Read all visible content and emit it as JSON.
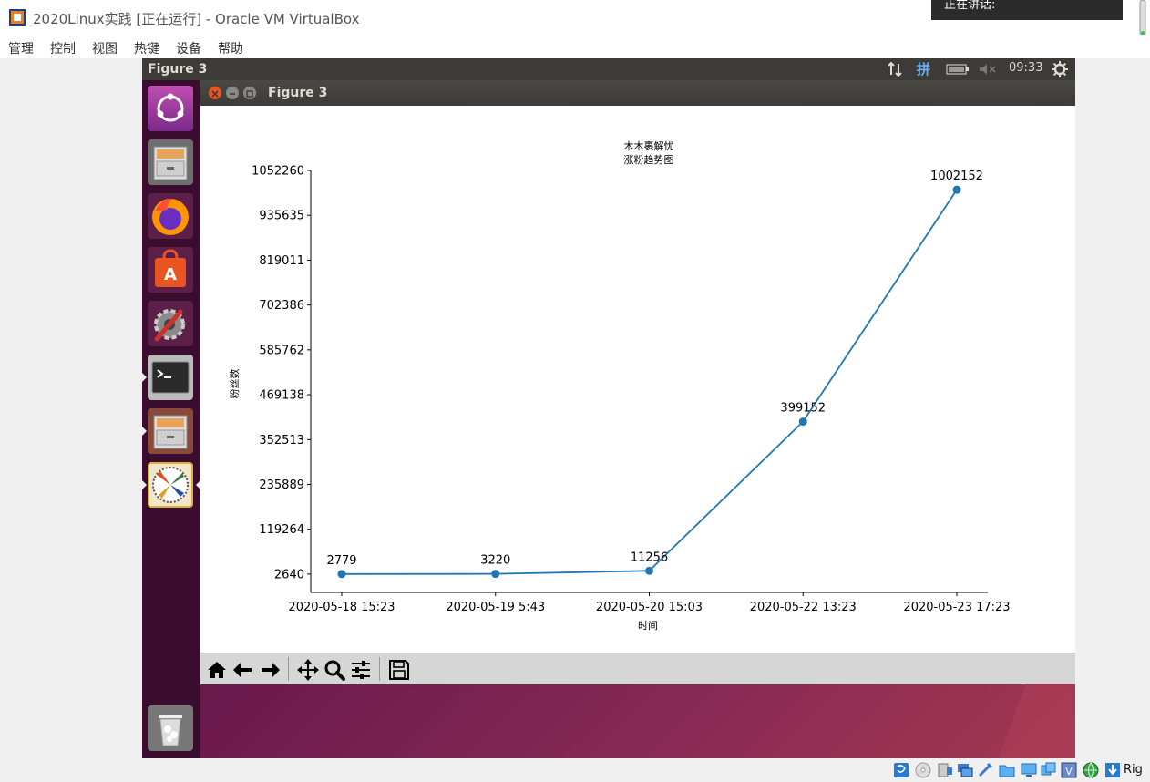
{
  "host": {
    "window_title": "2020Linux实践 [正在运行] - Oracle VM VirtualBox",
    "menu": [
      "管理",
      "控制",
      "视图",
      "热键",
      "设备",
      "帮助"
    ],
    "ime_popup": "正在讲话:",
    "status_text": "Rig"
  },
  "guest": {
    "topbar_title": "Figure 3",
    "indicator_ime": "拼",
    "clock": "09:33",
    "launcher_icons": [
      "ubuntu-dash-icon",
      "file-cabinet-icon",
      "firefox-icon",
      "software-center-icon",
      "system-settings-icon",
      "terminal-icon",
      "file-manager-icon",
      "matplotlib-icon",
      "trash-icon"
    ]
  },
  "figure_window": {
    "title": "Figure 3"
  },
  "chart_data": {
    "type": "line",
    "title": "木木裹解忧\n涨粉趋势图",
    "xlabel": "时间",
    "ylabel": "粉丝数",
    "categories": [
      "2020-05-18 15:23",
      "2020-05-19 5:43",
      "2020-05-20 15:03",
      "2020-05-22 13:23",
      "2020-05-23 17:23"
    ],
    "values": [
      2779,
      3220,
      11256,
      399152,
      1002152
    ],
    "data_labels": [
      "2779",
      "3220",
      "11256",
      "399152",
      "1002152"
    ],
    "yticks": [
      2640,
      119264,
      235889,
      352513,
      469138,
      585762,
      702386,
      819011,
      935635,
      1052260
    ],
    "ylim": [
      -45000,
      1052260
    ],
    "line_color": "#1f77b4",
    "grid": false
  }
}
